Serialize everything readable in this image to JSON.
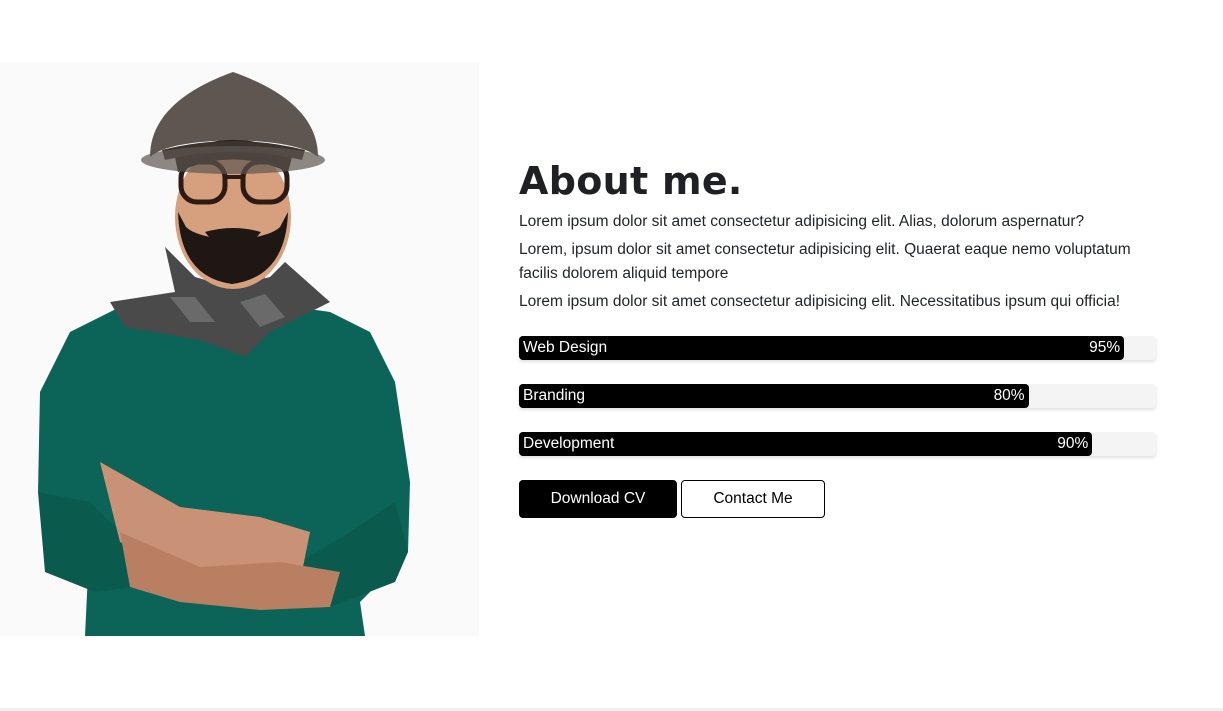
{
  "about": {
    "title": "About me.",
    "paragraphs": [
      "Lorem ipsum dolor sit amet consectetur adipisicing elit. Alias, dolorum aspernatur?",
      "Lorem, ipsum dolor sit amet consectetur adipisicing elit. Quaerat eaque nemo voluptatum facilis dolorem aliquid tempore",
      "Lorem ipsum dolor sit amet consectetur adipisicing elit. Necessitatibus ipsum qui officia!"
    ]
  },
  "skills": [
    {
      "label": "Web Design",
      "percent_text": "95%",
      "percent": 95
    },
    {
      "label": "Branding",
      "percent_text": "80%",
      "percent": 80
    },
    {
      "label": "Development",
      "percent_text": "90%",
      "percent": 90
    }
  ],
  "buttons": {
    "download_label": "Download CV",
    "contact_label": "Contact Me"
  },
  "colors": {
    "accent": "#000000",
    "sweater": "#0b6457",
    "panel_bg": "#fafafa"
  }
}
